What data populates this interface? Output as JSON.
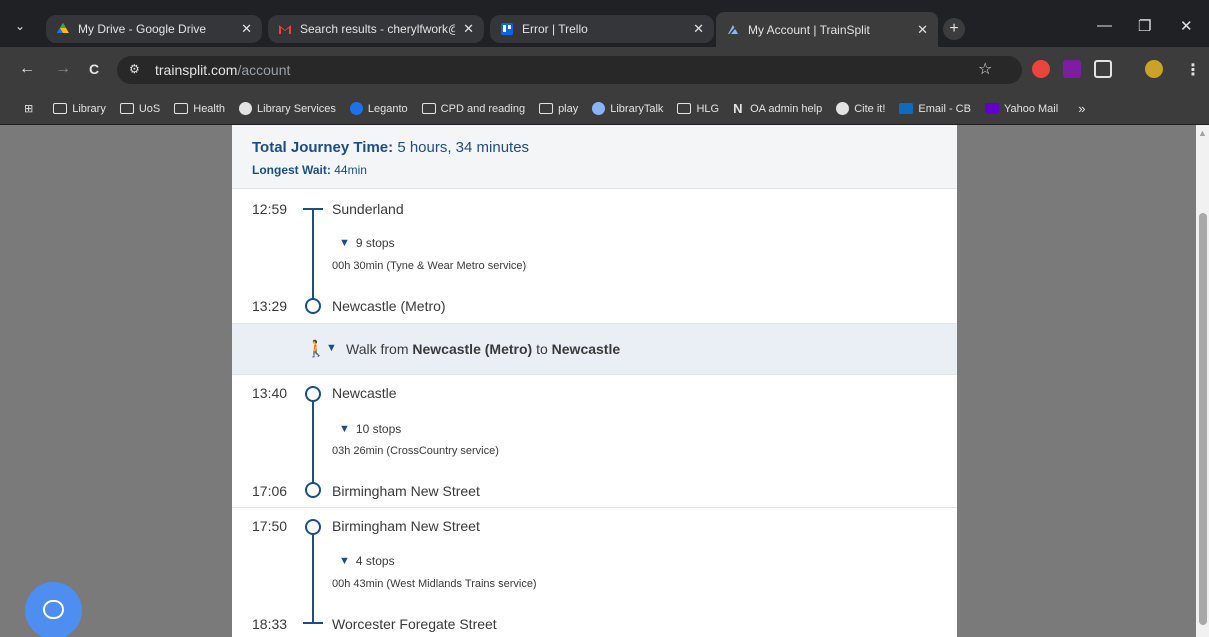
{
  "tabs": [
    {
      "label": "My Drive - Google Drive",
      "icon": "google-drive-icon",
      "close": "✕"
    },
    {
      "label": "Search results - cherylfwork@gm",
      "icon": "gmail-icon",
      "close": "✕"
    },
    {
      "label": "Error | Trello",
      "icon": "trello-icon",
      "close": "✕"
    },
    {
      "label": "My Account | TrainSplit",
      "icon": "trainsplit-icon",
      "close": "✕"
    }
  ],
  "new_tab": "+",
  "window": {
    "minimize": "—",
    "restore": "❐",
    "close": "✕"
  },
  "nav": {
    "back": "←",
    "forward": "→",
    "reload": "C"
  },
  "url": {
    "host": "trainsplit.com",
    "path": "/account"
  },
  "bookmarks": [
    {
      "label": "Library",
      "icon": "folder-icon"
    },
    {
      "label": "UoS",
      "icon": "folder-icon"
    },
    {
      "label": "Health",
      "icon": "folder-icon"
    },
    {
      "label": "Library Services",
      "icon": "globe-icon"
    },
    {
      "label": "Leganto",
      "icon": "leganto-icon"
    },
    {
      "label": "CPD and reading",
      "icon": "folder-icon"
    },
    {
      "label": "play",
      "icon": "folder-icon"
    },
    {
      "label": "LibraryTalk",
      "icon": "cloud-icon"
    },
    {
      "label": "HLG",
      "icon": "folder-icon"
    },
    {
      "label": "OA admin help",
      "icon": "notion-icon"
    },
    {
      "label": "Cite it!",
      "icon": "globe-icon"
    },
    {
      "label": "Email - CB",
      "icon": "outlook-icon"
    },
    {
      "label": "Yahoo Mail",
      "icon": "yahoo-mail-icon"
    }
  ],
  "bookmarks_more": "»",
  "summary": {
    "total_label": "Total Journey Time:",
    "total_value": "5 hours, 34 minutes",
    "wait_label": "Longest Wait:",
    "wait_value": "44min"
  },
  "legs": [
    {
      "dep_time": "12:59",
      "from": "Sunderland",
      "stops": "9 stops",
      "service": "00h 30min (Tyne & Wear Metro service)",
      "arr_time": "13:29",
      "to": "Newcastle (Metro)"
    },
    {
      "dep_time": "13:40",
      "from": "Newcastle",
      "stops": "10 stops",
      "service": "03h 26min (CrossCountry service)",
      "arr_time": "17:06",
      "to": "Birmingham New Street"
    },
    {
      "dep_time": "17:50",
      "from": "Birmingham New Street",
      "stops": "4 stops",
      "service": "00h 43min (West Midlands Trains service)",
      "arr_time": "18:33",
      "to": "Worcester Foregate Street"
    }
  ],
  "walk": {
    "prefix": "Walk from",
    "from": "Newcastle (Metro)",
    "middle": "to",
    "to": "Newcastle"
  },
  "colors": {
    "accent": "#1b4d86",
    "chat": "#4d8ef0"
  }
}
